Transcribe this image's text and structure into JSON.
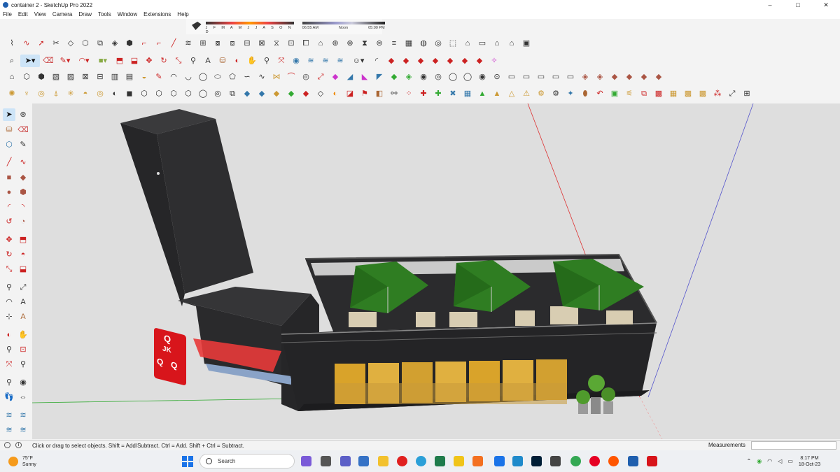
{
  "window": {
    "title": "container 2 - SketchUp Pro 2022",
    "minimize": "–",
    "maximize": "□",
    "close": "✕"
  },
  "menu": [
    "File",
    "Edit",
    "View",
    "Camera",
    "Draw",
    "Tools",
    "Window",
    "Extensions",
    "Help"
  ],
  "shadows": {
    "months": "J F M A M J J A S O N D",
    "time_start": "06:55 AM",
    "time_mid": "Noon",
    "time_end": "05:00 PM"
  },
  "status": {
    "hint": "Click or drag to select objects. Shift = Add/Subtract. Ctrl = Add. Shift + Ctrl = Subtract.",
    "measurements_label": "Measurements",
    "measurements_value": ""
  },
  "model": {
    "sign_letters": [
      "Q",
      "JK",
      "Q",
      "Q"
    ]
  },
  "taskbar": {
    "weather_temp": "75°F",
    "weather_desc": "Sunny",
    "search_placeholder": "Search",
    "time": "8:17 PM",
    "date": "18-Oct-23"
  },
  "colors": {
    "container": "#2b2b2d",
    "umbrella": "#2f7d22",
    "sign": "#d8151b",
    "glass": "#d9a32a"
  }
}
